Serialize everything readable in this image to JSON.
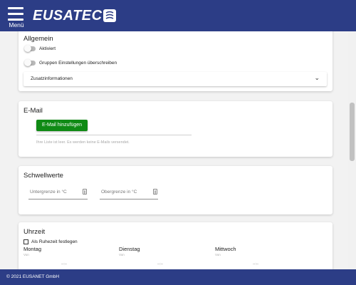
{
  "header": {
    "menu_label": "Menü",
    "logo_text": "EUSATEC"
  },
  "general": {
    "title": "Allgemein",
    "toggle_active_label": "Aktiviert",
    "toggle_override_label": "Gruppen Einstellungen überschreiben",
    "expander_label": "Zusatzinformationen"
  },
  "email": {
    "title": "E-Mail",
    "add_button_label": "E-Mail hinzufügen",
    "empty_hint": "Ihre Liste ist leer. Es werden keine E-Mails versendet."
  },
  "thresholds": {
    "title": "Schwellwerte",
    "lower_placeholder": "Untergrenze in °C",
    "upper_placeholder": "Obergrenze in °C"
  },
  "time": {
    "title": "Uhrzeit",
    "rest_checkbox_label": "Als Ruhezeit festlegen",
    "days": [
      {
        "label": "Montag",
        "sub": "Von"
      },
      {
        "label": "Dienstag",
        "sub": "Von"
      },
      {
        "label": "Mittwoch",
        "sub": "Von"
      }
    ],
    "time_sep": "--:--"
  },
  "footer": {
    "copyright": "© 2021 EUSANET GmbH"
  },
  "colors": {
    "header_bg": "#2c3d86",
    "button_green": "#0f8a14"
  }
}
